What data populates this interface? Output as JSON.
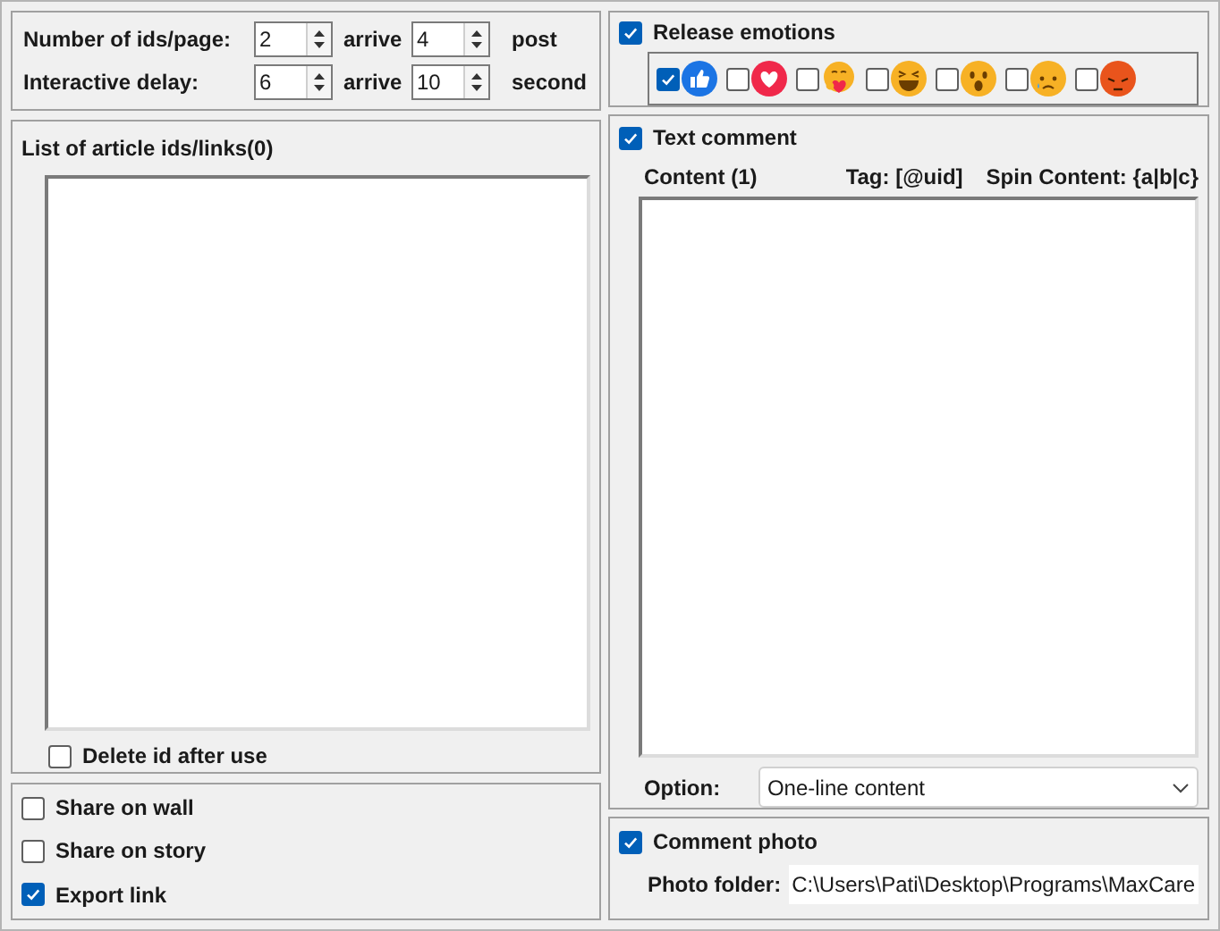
{
  "ids_per_page": {
    "label": "Number of ids/page:",
    "from": "2",
    "sep": "arrive",
    "to": "4",
    "unit": "post"
  },
  "delay": {
    "label": "Interactive delay:",
    "from": "6",
    "sep": "arrive",
    "to": "10",
    "unit": "second"
  },
  "article_list": {
    "title": "List of article ids/links(0)",
    "delete_after_use": {
      "label": "Delete id after use",
      "checked": false
    }
  },
  "share_options": [
    {
      "label": "Share on wall",
      "checked": false
    },
    {
      "label": "Share on story",
      "checked": false
    },
    {
      "label": "Export link",
      "checked": true
    }
  ],
  "release_emotions": {
    "label": "Release emotions",
    "checked": true,
    "reactions": [
      {
        "kind": "like",
        "checked": true
      },
      {
        "kind": "love",
        "checked": false
      },
      {
        "kind": "care",
        "checked": false
      },
      {
        "kind": "haha",
        "checked": false
      },
      {
        "kind": "wow",
        "checked": false
      },
      {
        "kind": "sad",
        "checked": false
      },
      {
        "kind": "angry",
        "checked": false
      }
    ]
  },
  "text_comment": {
    "label": "Text comment",
    "checked": true,
    "content_label": "Content (1)",
    "tag_hint": "Tag: [@uid]",
    "spin_hint": "Spin Content: {a|b|c}",
    "option_label": "Option:",
    "option_value": "One-line content"
  },
  "comment_photo": {
    "label": "Comment photo",
    "checked": true,
    "folder_label": "Photo folder:",
    "folder_value": "C:\\Users\\Pati\\Desktop\\Programs\\MaxCare"
  }
}
